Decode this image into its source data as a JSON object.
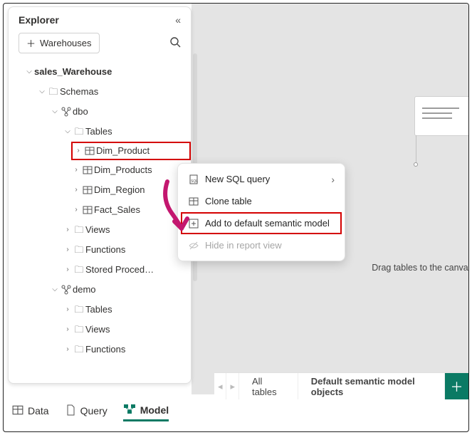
{
  "explorer": {
    "title": "Explorer",
    "addButton": "Warehouses",
    "tree": {
      "warehouse": "sales_Warehouse",
      "schemas_label": "Schemas",
      "schema1": {
        "name": "dbo",
        "tables_label": "Tables",
        "tables": [
          "Dim_Product",
          "Dim_Products",
          "Dim_Region",
          "Fact_Sales"
        ],
        "views_label": "Views",
        "functions_label": "Functions",
        "sprocs_label": "Stored Proced…"
      },
      "schema2": {
        "name": "demo",
        "tables_label": "Tables",
        "views_label": "Views",
        "functions_label": "Functions"
      }
    }
  },
  "contextMenu": {
    "items": [
      "New SQL query",
      "Clone table",
      "Add to default semantic model",
      "Hide in report view"
    ]
  },
  "canvas": {
    "hint": "Drag tables to the canvas"
  },
  "bottomTabs": {
    "all": "All tables",
    "default": "Default semantic model objects"
  },
  "viewTabs": {
    "data": "Data",
    "query": "Query",
    "model": "Model"
  }
}
